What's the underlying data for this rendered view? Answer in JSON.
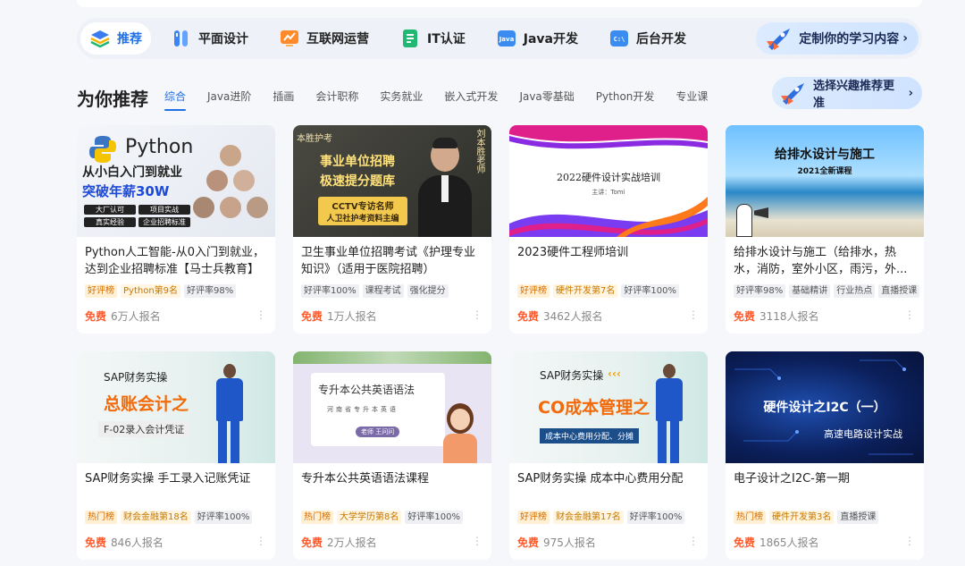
{
  "categories": [
    {
      "label": "推荐",
      "icon": "layers-icon",
      "color": "#3a7cf0",
      "active": true
    },
    {
      "label": "平面设计",
      "icon": "pen-tools-icon",
      "color": "#3a84f5"
    },
    {
      "label": "互联网运营",
      "icon": "growth-chart-icon",
      "color": "#ff8a2a"
    },
    {
      "label": "IT认证",
      "icon": "certificate-icon",
      "color": "#20b872"
    },
    {
      "label": "Java开发",
      "icon": "java-icon",
      "color": "#3a8cf0"
    },
    {
      "label": "后台开发",
      "icon": "terminal-icon",
      "color": "#3a8cf0"
    }
  ],
  "custom_label": "定制你的学习内容",
  "chevron": "›",
  "section": {
    "title": "为你推荐",
    "tabs": [
      "综合",
      "Java进阶",
      "插画",
      "会计职称",
      "实务就业",
      "嵌入式开发",
      "Java零基础",
      "Python开发",
      "专业课"
    ],
    "interest_label": "选择兴趣推荐更准"
  },
  "courses": [
    {
      "title": "Python人工智能-从0入门到就业，达到企业招聘标准【马士兵教育】",
      "tags": [
        {
          "text": "好评榜",
          "kind": "hot"
        },
        {
          "text": "Python第9名",
          "kind": "rank"
        },
        {
          "text": "好评率98%",
          "kind": "plain"
        }
      ],
      "price": "免费",
      "enrolled": "6万人报名",
      "thumb": {
        "line1": "Python",
        "line2": "从小白入门到就业",
        "line3": "突破年薪30W",
        "chips": [
          "大厂认可",
          "项目实战",
          "真实经验",
          "企业招聘标准"
        ]
      }
    },
    {
      "title": "卫生事业单位招聘考试《护理专业知识》（适用于医院招聘）",
      "tags": [
        {
          "text": "好评率100%",
          "kind": "plain"
        },
        {
          "text": "课程考试",
          "kind": "plain"
        },
        {
          "text": "强化提分",
          "kind": "plain"
        }
      ],
      "price": "免费",
      "enrolled": "1万人报名",
      "thumb": {
        "logo": "本胜护考",
        "line1": "事业单位招聘",
        "line2": "极速提分题库",
        "line3": "CCTV专访名师",
        "line4": "人卫社护考资料主编",
        "side": "刘本胜老师"
      }
    },
    {
      "title": "2023硬件工程师培训",
      "tags": [
        {
          "text": "好评榜",
          "kind": "hot"
        },
        {
          "text": "硬件开发第7名",
          "kind": "rank"
        },
        {
          "text": "好评率100%",
          "kind": "plain"
        }
      ],
      "price": "免费",
      "enrolled": "3462人报名",
      "thumb": {
        "line1": "2022硬件设计实战培训",
        "line2": "主讲：Tomi"
      }
    },
    {
      "title": "给排水设计与施工（给排水，热水，消防，室外小区，雨污，外...",
      "tags": [
        {
          "text": "好评率98%",
          "kind": "plain"
        },
        {
          "text": "基础精讲",
          "kind": "plain"
        },
        {
          "text": "行业热点",
          "kind": "plain"
        },
        {
          "text": "直播授课",
          "kind": "plain"
        }
      ],
      "price": "免费",
      "enrolled": "3118人报名",
      "thumb": {
        "line1": "给排水设计与施工",
        "line2": "2021全新课程"
      }
    },
    {
      "title": "SAP财务实操 手工录入记账凭证",
      "tags": [
        {
          "text": "热门榜",
          "kind": "hot"
        },
        {
          "text": "财会金融第18名",
          "kind": "rank"
        },
        {
          "text": "好评率100%",
          "kind": "plain"
        }
      ],
      "price": "免费",
      "enrolled": "846人报名",
      "thumb": {
        "line1": "SAP财务实操",
        "line2": "总账会计之",
        "line3": "F-02录入会计凭证"
      }
    },
    {
      "title": "专升本公共英语语法课程",
      "tags": [
        {
          "text": "热门榜",
          "kind": "hot"
        },
        {
          "text": "大学学历第8名",
          "kind": "rank"
        },
        {
          "text": "好评率100%",
          "kind": "plain"
        }
      ],
      "price": "免费",
      "enrolled": "2万人报名",
      "thumb": {
        "line1": "专升本公共英语语法",
        "line2": "河南省专升本英语",
        "line3": "老师 王问问"
      }
    },
    {
      "title": "SAP财务实操 成本中心费用分配",
      "tags": [
        {
          "text": "好评榜",
          "kind": "hot"
        },
        {
          "text": "财会金融第17名",
          "kind": "rank"
        },
        {
          "text": "好评率100%",
          "kind": "plain"
        }
      ],
      "price": "免费",
      "enrolled": "975人报名",
      "thumb": {
        "line1": "SAP财务实操",
        "line2": "CO成本管理之",
        "line3": "成本中心费用分配、分摊"
      }
    },
    {
      "title": "电子设计之I2C-第一期",
      "tags": [
        {
          "text": "热门榜",
          "kind": "hot"
        },
        {
          "text": "硬件开发第3名",
          "kind": "rank"
        },
        {
          "text": "直播授课",
          "kind": "plain"
        }
      ],
      "price": "免费",
      "enrolled": "1865人报名",
      "thumb": {
        "line1": "硬件设计之I2C（一）",
        "line2": "高速电路设计实战"
      }
    }
  ]
}
